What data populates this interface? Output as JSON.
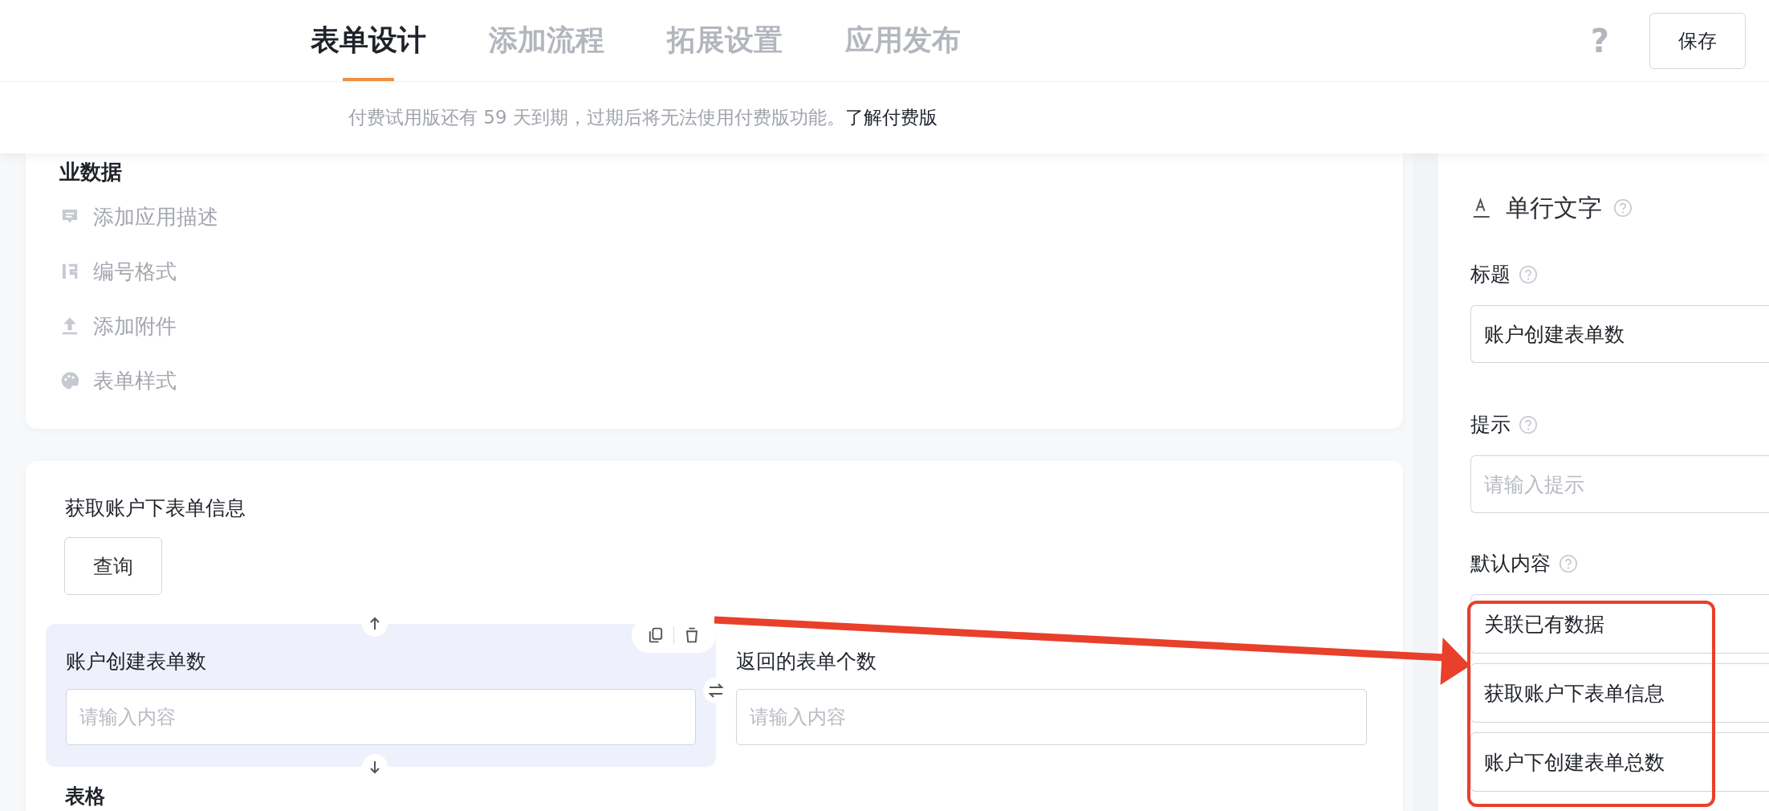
{
  "header": {
    "tabs": [
      {
        "label": "表单设计",
        "selected": true
      },
      {
        "label": "添加流程",
        "selected": false
      },
      {
        "label": "拓展设置",
        "selected": false
      },
      {
        "label": "应用发布",
        "selected": false
      }
    ],
    "help_icon": "?",
    "save_button": "保存"
  },
  "notice": {
    "text": "付费试用版还有 59 天到期，过期后将无法使用付费版功能。",
    "link": "了解付费版"
  },
  "settings_card": {
    "heading": "业数据",
    "items": [
      {
        "kind": "description",
        "label": "添加应用描述"
      },
      {
        "kind": "number",
        "label": "编号格式"
      },
      {
        "kind": "upload",
        "label": "添加附件"
      },
      {
        "kind": "palette",
        "label": "表单样式"
      }
    ]
  },
  "form_card": {
    "section_title": "获取账户下表单信息",
    "query_button": "查询",
    "fields": [
      {
        "label": "账户创建表单数",
        "placeholder": "请输入内容",
        "selected": true
      },
      {
        "label": "返回的表单个数",
        "placeholder": "请输入内容",
        "selected": false
      }
    ],
    "next_title": "表格"
  },
  "properties": {
    "title": "单行文字",
    "title_label": "标题",
    "title_value": "账户创建表单数",
    "hint_label": "提示",
    "hint_placeholder": "请输入提示",
    "default_label": "默认内容",
    "default_options": [
      "关联已有数据",
      "获取账户下表单信息",
      "账户下创建表单总数"
    ]
  }
}
